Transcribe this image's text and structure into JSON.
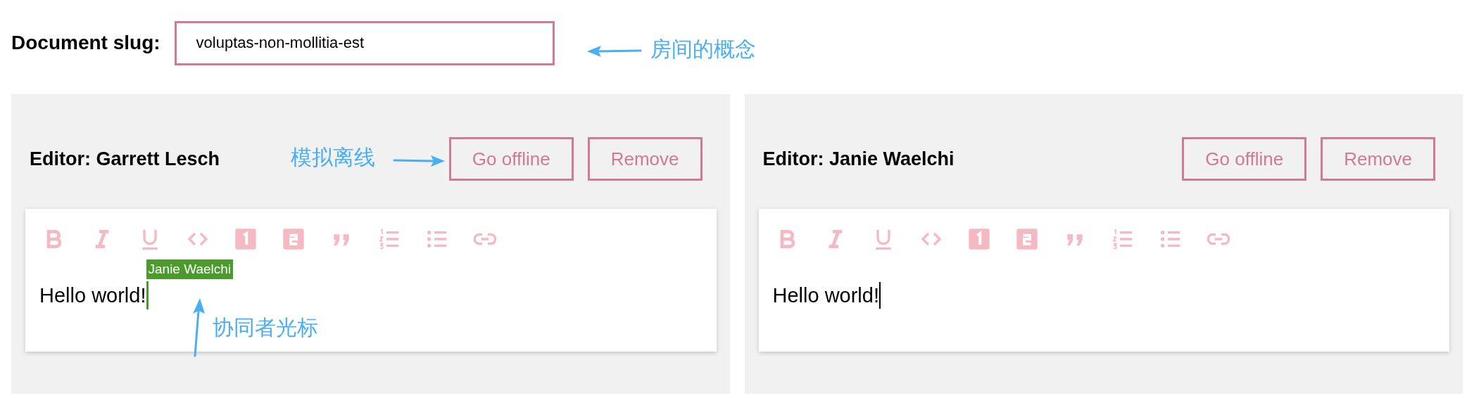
{
  "slug": {
    "label": "Document slug:",
    "value": "voluptas-non-mollitia-est"
  },
  "editors": [
    {
      "heading": "Editor: Garrett Lesch",
      "buttons": [
        "Go offline",
        "Remove"
      ],
      "text": "Hello world!",
      "focused": false,
      "remote_cursor": {
        "label": "Janie Waelchi",
        "color": "#4a9a2c"
      }
    },
    {
      "heading": "Editor: Janie Waelchi",
      "buttons": [
        "Go offline",
        "Remove"
      ],
      "text": "Hello world!",
      "focused": true
    }
  ],
  "annotations": [
    {
      "kind": "slug",
      "text": "房间的概念"
    },
    {
      "kind": "offline",
      "text": "模拟离线"
    },
    {
      "kind": "cursor",
      "text": "协同者光标"
    }
  ]
}
